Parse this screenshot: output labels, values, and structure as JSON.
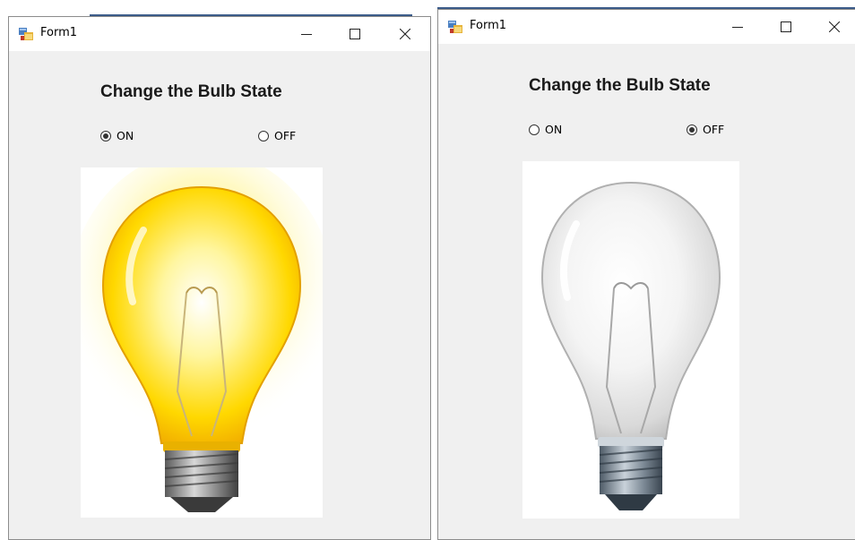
{
  "windows": [
    {
      "title": "Form1",
      "heading": "Change the Bulb State",
      "options": [
        {
          "label": "ON",
          "checked": true
        },
        {
          "label": "OFF",
          "checked": false
        }
      ],
      "bulb_state": "on"
    },
    {
      "title": "Form1",
      "heading": "Change the Bulb State",
      "options": [
        {
          "label": "ON",
          "checked": false
        },
        {
          "label": "OFF",
          "checked": true
        }
      ],
      "bulb_state": "off"
    }
  ],
  "icons": {
    "app": "form-app-icon",
    "minimize": "minimize-icon",
    "maximize": "maximize-icon",
    "close": "close-icon",
    "bulb_on": "lit-bulb-icon",
    "bulb_off": "unlit-bulb-icon"
  },
  "colors": {
    "window_bg": "#f0f0f0",
    "titlebar_bg": "#ffffff",
    "bulb_on": "#ffd400",
    "bulb_off": "#e6e6e6"
  }
}
